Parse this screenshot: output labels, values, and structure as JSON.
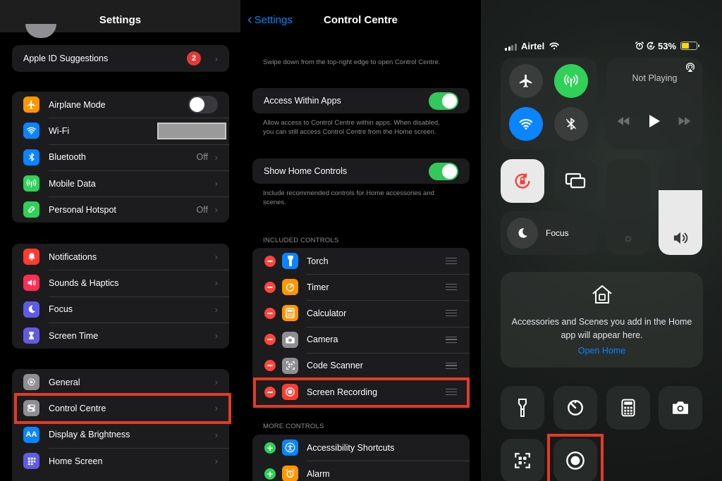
{
  "settings": {
    "title": "Settings",
    "apple_id": {
      "label": "Apple ID Suggestions",
      "badge": "2"
    },
    "group1": [
      {
        "label": "Airplane Mode",
        "icon": "airplane-icon",
        "color": "#ff9500",
        "value": ""
      },
      {
        "label": "Wi-Fi",
        "icon": "wifi-icon",
        "color": "#0a84ff",
        "value": ""
      },
      {
        "label": "Bluetooth",
        "icon": "bluetooth-icon",
        "color": "#0a84ff",
        "value": "Off"
      },
      {
        "label": "Mobile Data",
        "icon": "antenna-icon",
        "color": "#30d158",
        "value": ""
      },
      {
        "label": "Personal Hotspot",
        "icon": "hotspot-icon",
        "color": "#30d158",
        "value": "Off"
      }
    ],
    "group2": [
      {
        "label": "Notifications",
        "icon": "bell-icon",
        "color": "#ff3b30"
      },
      {
        "label": "Sounds & Haptics",
        "icon": "speaker-icon",
        "color": "#ff2d55"
      },
      {
        "label": "Focus",
        "icon": "moon-icon",
        "color": "#5e5ce6"
      },
      {
        "label": "Screen Time",
        "icon": "hourglass-icon",
        "color": "#5e5ce6"
      }
    ],
    "group3": [
      {
        "label": "General",
        "icon": "gear-icon",
        "color": "#8e8e93"
      },
      {
        "label": "Control Centre",
        "icon": "switches-icon",
        "color": "#8e8e93"
      },
      {
        "label": "Display & Brightness",
        "icon": "text-size-icon",
        "color": "#0a84ff"
      },
      {
        "label": "Home Screen",
        "icon": "grid-icon",
        "color": "#5e5ce6"
      }
    ]
  },
  "control_centre_settings": {
    "back_label": "Settings",
    "title": "Control Centre",
    "intro": "Swipe down from the top-right edge to open Control Centre.",
    "access_within_apps": {
      "label": "Access Within Apps",
      "on": true
    },
    "access_footer": "Allow access to Control Centre within apps. When disabled, you can still access Control Centre from the Home screen.",
    "show_home_controls": {
      "label": "Show Home Controls",
      "on": true
    },
    "home_footer": "Include recommended controls for Home accessories and scenes.",
    "included_header": "INCLUDED CONTROLS",
    "included": [
      {
        "label": "Torch",
        "icon": "torch-icon",
        "color": "#0a84ff"
      },
      {
        "label": "Timer",
        "icon": "timer-icon",
        "color": "#ff9500"
      },
      {
        "label": "Calculator",
        "icon": "calculator-icon",
        "color": "#ff9500"
      },
      {
        "label": "Camera",
        "icon": "camera-icon",
        "color": "#8e8e93"
      },
      {
        "label": "Code Scanner",
        "icon": "qr-icon",
        "color": "#8e8e93"
      },
      {
        "label": "Screen Recording",
        "icon": "record-icon",
        "color": "#ff3b30"
      }
    ],
    "more_header": "MORE CONTROLS",
    "more": [
      {
        "label": "Accessibility Shortcuts",
        "icon": "accessibility-icon",
        "color": "#0a84ff"
      },
      {
        "label": "Alarm",
        "icon": "alarm-icon",
        "color": "#ff9500"
      }
    ]
  },
  "control_centre": {
    "carrier": "Airtel",
    "battery_percent": "53%",
    "battery_level": 0.53,
    "now_playing": "Not Playing",
    "focus_label": "Focus",
    "brightness_level": 0.0,
    "volume_level": 0.68,
    "home_message": "Accessories and Scenes you add in the Home app will appear here.",
    "home_line1": "Accessories and Scenes you add in the Home",
    "home_line2": "app will appear here.",
    "open_home": "Open Home",
    "highlight_color": "#e23b26"
  }
}
